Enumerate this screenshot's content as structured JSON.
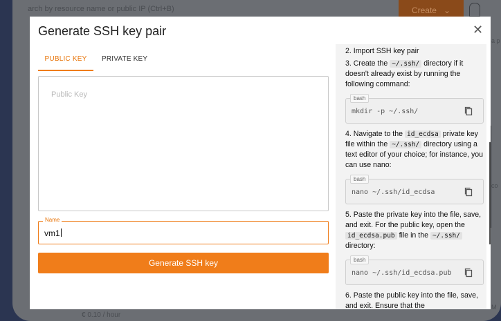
{
  "background": {
    "search_placeholder": "arch by resource name or public IP (Ctrl+B)",
    "create_button": "Create",
    "price": "€ 0.10 / hour",
    "edge_fragment_1": "a p",
    "edge_fragment_2": "co",
    "edge_fragment_3": "M"
  },
  "modal": {
    "title": "Generate SSH key pair",
    "close_symbol": "✕",
    "tabs": [
      {
        "label": "PUBLIC KEY",
        "active": true
      },
      {
        "label": "PRIVATE KEY",
        "active": false
      }
    ],
    "public_key_placeholder": "Public Key",
    "name_field": {
      "label": "Name",
      "value": "vm1"
    },
    "generate_button": "Generate SSH key"
  },
  "instructions": {
    "step2": "2. Import SSH key pair",
    "step3": {
      "pre": "3. Create the ",
      "code": "~/.ssh/",
      "post": " directory if it doesn't already exist by running the following command:"
    },
    "block1": {
      "lang": "bash",
      "cmd": "mkdir -p ~/.ssh/"
    },
    "step4": {
      "pre": "4. Navigate to the ",
      "code1": "id_ecdsa",
      "mid": " private key file within the ",
      "code2": "~/.ssh/",
      "post": " directory using a text editor of your choice; for instance, you can use nano:"
    },
    "block2": {
      "lang": "bash",
      "cmd": "nano ~/.ssh/id_ecdsa"
    },
    "step5": {
      "pre": "5. Paste the private key into the file, save, and exit. For the public key, open the ",
      "code1": "id_ecdsa.pub",
      "mid": " file in the ",
      "code2": "~/.ssh/",
      "post": " directory:"
    },
    "block3": {
      "lang": "bash",
      "cmd": "nano ~/.ssh/id_ecdsa.pub"
    },
    "step6": "6. Paste the public key into the file, save, and exit. Ensure that the"
  },
  "colors": {
    "accent": "#f07d1a",
    "page_bg": "#2b3551",
    "panel_bg": "#f3f3f3"
  }
}
